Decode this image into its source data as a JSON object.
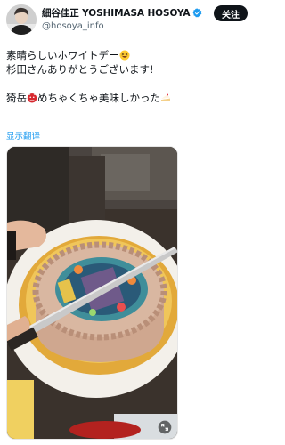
{
  "author": {
    "display_name": "細谷佳正 YOSHIMASA HOSOYA",
    "handle": "@hosoya_info",
    "verified_icon": "verified-badge-icon",
    "avatar": "avatar-photo"
  },
  "follow_button": {
    "label": "关注"
  },
  "tweet": {
    "line1": "素晴らしいホワイトデー",
    "line2": "杉田さんありがとうございます!",
    "line3_before": "猗岳",
    "line3_after": "めちゃくちゃ美味しかった",
    "emojis": [
      "grinning-squint-emoji",
      "ogre-mask-emoji",
      "cake-slice-emoji"
    ]
  },
  "translate_link": "显示翻译",
  "media": {
    "kind": "photo",
    "subject": "decorated-cake-being-cut",
    "expand_icon": "expand-icon"
  },
  "colors": {
    "link": "#1d9bf0",
    "verified": "#1d9bf0",
    "button_bg": "#0f1419",
    "handle": "#536471"
  }
}
